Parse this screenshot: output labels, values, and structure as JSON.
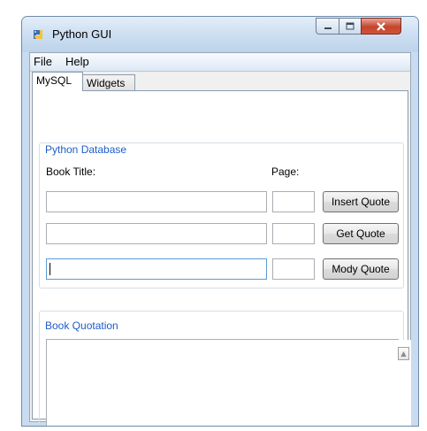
{
  "window": {
    "title": "Python GUI",
    "caption_buttons": {
      "minimize_icon": "minimize-icon",
      "maximize_icon": "maximize-icon",
      "close_icon": "close-icon"
    }
  },
  "menu": {
    "items": [
      {
        "label": "File"
      },
      {
        "label": "Help"
      }
    ]
  },
  "tabs": [
    {
      "label": "MySQL",
      "selected": true
    },
    {
      "label": "Widgets",
      "selected": false
    }
  ],
  "database_group": {
    "title": "Python Database",
    "book_title_label": "Book Title:",
    "page_label": "Page:",
    "rows": [
      {
        "title_value": "",
        "page_value": "",
        "button_label": "Insert Quote"
      },
      {
        "title_value": "",
        "page_value": "",
        "button_label": "Get Quote"
      },
      {
        "title_value": "",
        "page_value": "",
        "button_label": "Mody Quote"
      }
    ]
  },
  "quotation_group": {
    "title": "Book Quotation",
    "text_value": ""
  },
  "colors": {
    "group_label": "#1f5cc7",
    "title_bar": "#cfe0f2",
    "close_button": "#c4452c"
  }
}
